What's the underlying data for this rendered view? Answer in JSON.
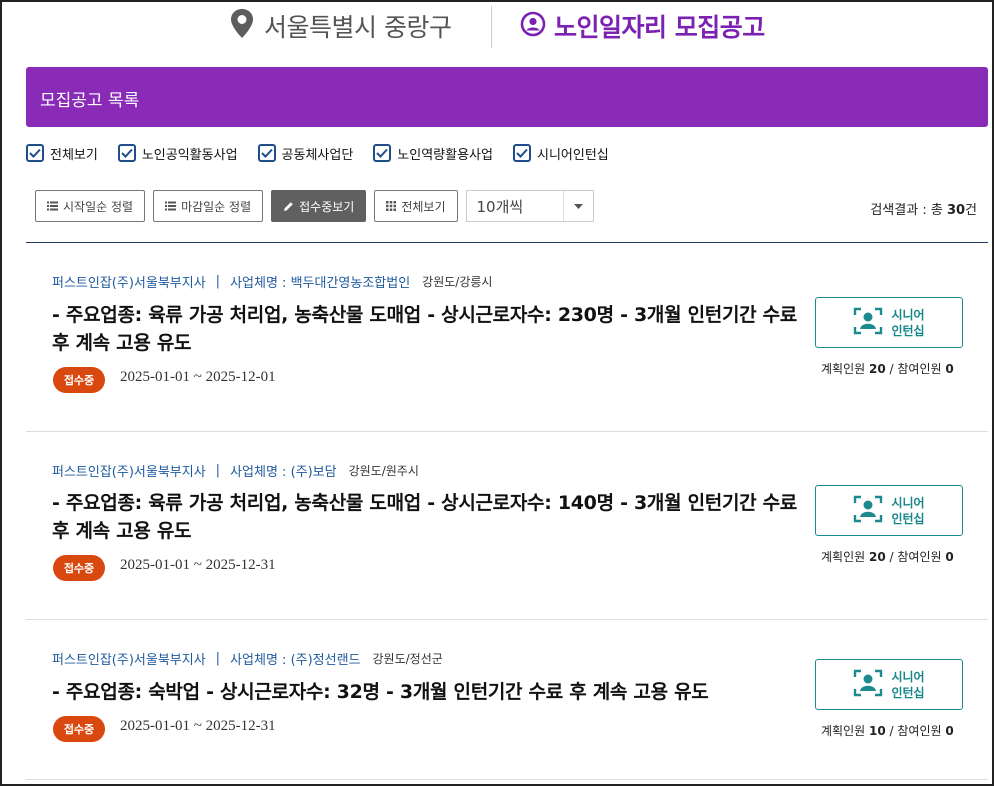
{
  "header": {
    "location": "서울특별시 중랑구",
    "title": "노인일자리 모집공고"
  },
  "banner": {
    "title": "모집공고 목록"
  },
  "filters": [
    {
      "label": "전체보기",
      "checked": true
    },
    {
      "label": "노인공익활동사업",
      "checked": true
    },
    {
      "label": "공동체사업단",
      "checked": true
    },
    {
      "label": "노인역량활용사업",
      "checked": true
    },
    {
      "label": "시니어인턴십",
      "checked": true
    }
  ],
  "toolbar": {
    "sort_start": "시작일순 정렬",
    "sort_end": "마감일순 정렬",
    "receiving": "접수중보기",
    "view_all": "전체보기",
    "page_size": "10개씩",
    "result_prefix": "검색결과 : 총",
    "result_count": "30",
    "result_suffix": "건"
  },
  "items": [
    {
      "org": "퍼스트인잡(주)서울북부지사",
      "biz_label": "사업체명 :",
      "biz_name": "백두대간영농조합법인",
      "region": "강원도/강릉시",
      "desc": "- 주요업종: 육류 가공 처리업, 농축산물 도매업 - 상시근로자수: 230명 - 3개월 인턴기간 수료 후 계속 고용 유도",
      "status": "접수중",
      "period": "2025-01-01 ~ 2025-12-01",
      "type_line1": "시니어",
      "type_line2": "인턴십",
      "plan_label": "계획인원",
      "plan": "20",
      "join_label": "참여인원",
      "join": "0"
    },
    {
      "org": "퍼스트인잡(주)서울북부지사",
      "biz_label": "사업체명 :",
      "biz_name": "(주)보담",
      "region": "강원도/원주시",
      "desc": "- 주요업종: 육류 가공 처리업, 농축산물 도매업 - 상시근로자수: 140명 - 3개월 인턴기간 수료 후 계속 고용 유도",
      "status": "접수중",
      "period": "2025-01-01 ~ 2025-12-31",
      "type_line1": "시니어",
      "type_line2": "인턴십",
      "plan_label": "계획인원",
      "plan": "20",
      "join_label": "참여인원",
      "join": "0"
    },
    {
      "org": "퍼스트인잡(주)서울북부지사",
      "biz_label": "사업체명 :",
      "biz_name": "(주)정선랜드",
      "region": "강원도/정선군",
      "desc": "- 주요업종: 숙박업 - 상시근로자수: 32명 - 3개월 인턴기간 수료 후 계속 고용 유도",
      "status": "접수중",
      "period": "2025-01-01 ~ 2025-12-31",
      "type_line1": "시니어",
      "type_line2": "인턴십",
      "plan_label": "계획인원",
      "plan": "10",
      "join_label": "참여인원",
      "join": "0"
    }
  ],
  "colors": {
    "accent_purple": "#8a2bb8",
    "link_blue": "#1f5a9e",
    "badge_orange": "#d9480f",
    "teal": "#1d8a8f"
  },
  "icons": {
    "location": "map-pin-icon",
    "title": "user-circle-icon",
    "checkbox": "check-icon",
    "list": "list-icon",
    "pencil": "pencil-icon",
    "grid": "grid-icon",
    "dropdown": "caret-down-icon",
    "intern": "person-frame-icon"
  }
}
